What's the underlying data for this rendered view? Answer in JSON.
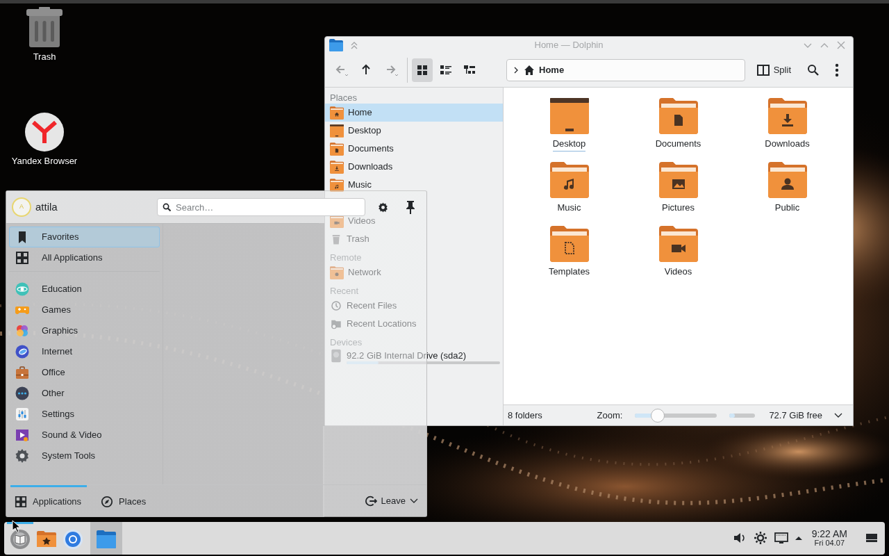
{
  "desktop_icons": [
    {
      "label": "Trash",
      "kind": "trash"
    },
    {
      "label": "Yandex Browser",
      "kind": "browser"
    }
  ],
  "dolphin": {
    "title": "Home — Dolphin",
    "nav": [
      {
        "kind": "back",
        "disabled": true
      },
      {
        "kind": "up",
        "disabled": false
      },
      {
        "kind": "forward",
        "disabled": true
      }
    ],
    "views": [
      {
        "kind": "icons",
        "selected": true
      },
      {
        "kind": "compact",
        "selected": false
      },
      {
        "kind": "details",
        "selected": false
      }
    ],
    "location": "Home",
    "split": "Split",
    "places": [
      {
        "heading": "Places",
        "items": [
          {
            "label": "Home",
            "kind": "home",
            "selected": true
          },
          {
            "label": "Desktop",
            "kind": "desktop",
            "selected": false
          },
          {
            "label": "Documents",
            "kind": "documents",
            "selected": false
          },
          {
            "label": "Downloads",
            "kind": "downloads",
            "selected": false
          },
          {
            "label": "Music",
            "kind": "music",
            "selected": false
          },
          {
            "kind": "covered"
          },
          {
            "label": "Videos",
            "kind": "videos",
            "selected": false
          },
          {
            "label": "Trash",
            "kind": "trash",
            "selected": false
          }
        ]
      },
      {
        "heading": "Remote",
        "items": [
          {
            "label": "Network",
            "kind": "network",
            "selected": false
          }
        ]
      },
      {
        "heading": "Recent",
        "items": [
          {
            "label": "Recent Files",
            "kind": "clock",
            "selected": false
          },
          {
            "label": "Recent Locations",
            "kind": "recent-locations",
            "selected": false
          }
        ]
      },
      {
        "heading": "Devices",
        "items": [
          {
            "label": "92.2 GiB Internal Drive (sda2)",
            "kind": "drive",
            "selected": false,
            "level": 0.21
          }
        ]
      }
    ],
    "folders": [
      {
        "label": "Desktop",
        "kind": "desktop",
        "focused": true
      },
      {
        "label": "Documents",
        "kind": "documents",
        "focused": false
      },
      {
        "label": "Downloads",
        "kind": "downloads",
        "focused": false
      },
      {
        "label": "Music",
        "kind": "music",
        "focused": false
      },
      {
        "label": "Pictures",
        "kind": "pictures",
        "focused": false
      },
      {
        "label": "Public",
        "kind": "public",
        "focused": false
      },
      {
        "label": "Templates",
        "kind": "templates",
        "focused": false
      },
      {
        "label": "Videos",
        "kind": "videos",
        "focused": false
      }
    ],
    "status": {
      "count": "8 folders",
      "zoom_label": "Zoom:",
      "zoom": {
        "level": 0.28
      },
      "disk": {
        "level": 0.21
      },
      "free": "72.7 GiB free"
    }
  },
  "menu": {
    "user": "attila",
    "avatar_letter": "A",
    "search_placeholder": "Search…",
    "top": [
      {
        "label": "Favorites",
        "kind": "bookmark",
        "selected": true
      },
      {
        "label": "All Applications",
        "kind": "grid",
        "selected": false
      }
    ],
    "categories": [
      {
        "label": "Education",
        "kind": "education",
        "selected": false
      },
      {
        "label": "Games",
        "kind": "games",
        "selected": false
      },
      {
        "label": "Graphics",
        "kind": "graphics",
        "selected": false
      },
      {
        "label": "Internet",
        "kind": "internet",
        "selected": false
      },
      {
        "label": "Office",
        "kind": "office",
        "selected": false
      },
      {
        "label": "Other",
        "kind": "other",
        "selected": false
      },
      {
        "label": "Settings",
        "kind": "settings",
        "selected": false
      },
      {
        "label": "Sound & Video",
        "kind": "sound-video",
        "selected": false
      },
      {
        "label": "System Tools",
        "kind": "system-tools",
        "selected": false
      }
    ],
    "tabs": [
      {
        "label": "Applications",
        "kind": "grid",
        "selected": true
      },
      {
        "label": "Places",
        "kind": "compass",
        "selected": false
      }
    ],
    "leave": "Leave"
  },
  "taskbar": {
    "tasks": [
      {
        "kind": "launcher",
        "selected": true,
        "open": false
      },
      {
        "kind": "folder-star",
        "selected": false,
        "open": false
      },
      {
        "kind": "browser",
        "selected": false,
        "open": false
      },
      {
        "kind": "file-manager",
        "selected": false,
        "open": true
      }
    ],
    "tray": [
      {
        "kind": "volume"
      },
      {
        "kind": "brightness"
      },
      {
        "kind": "network"
      },
      {
        "kind": "expand"
      }
    ],
    "time": "9:22 AM",
    "date": "Fri 04.07"
  }
}
